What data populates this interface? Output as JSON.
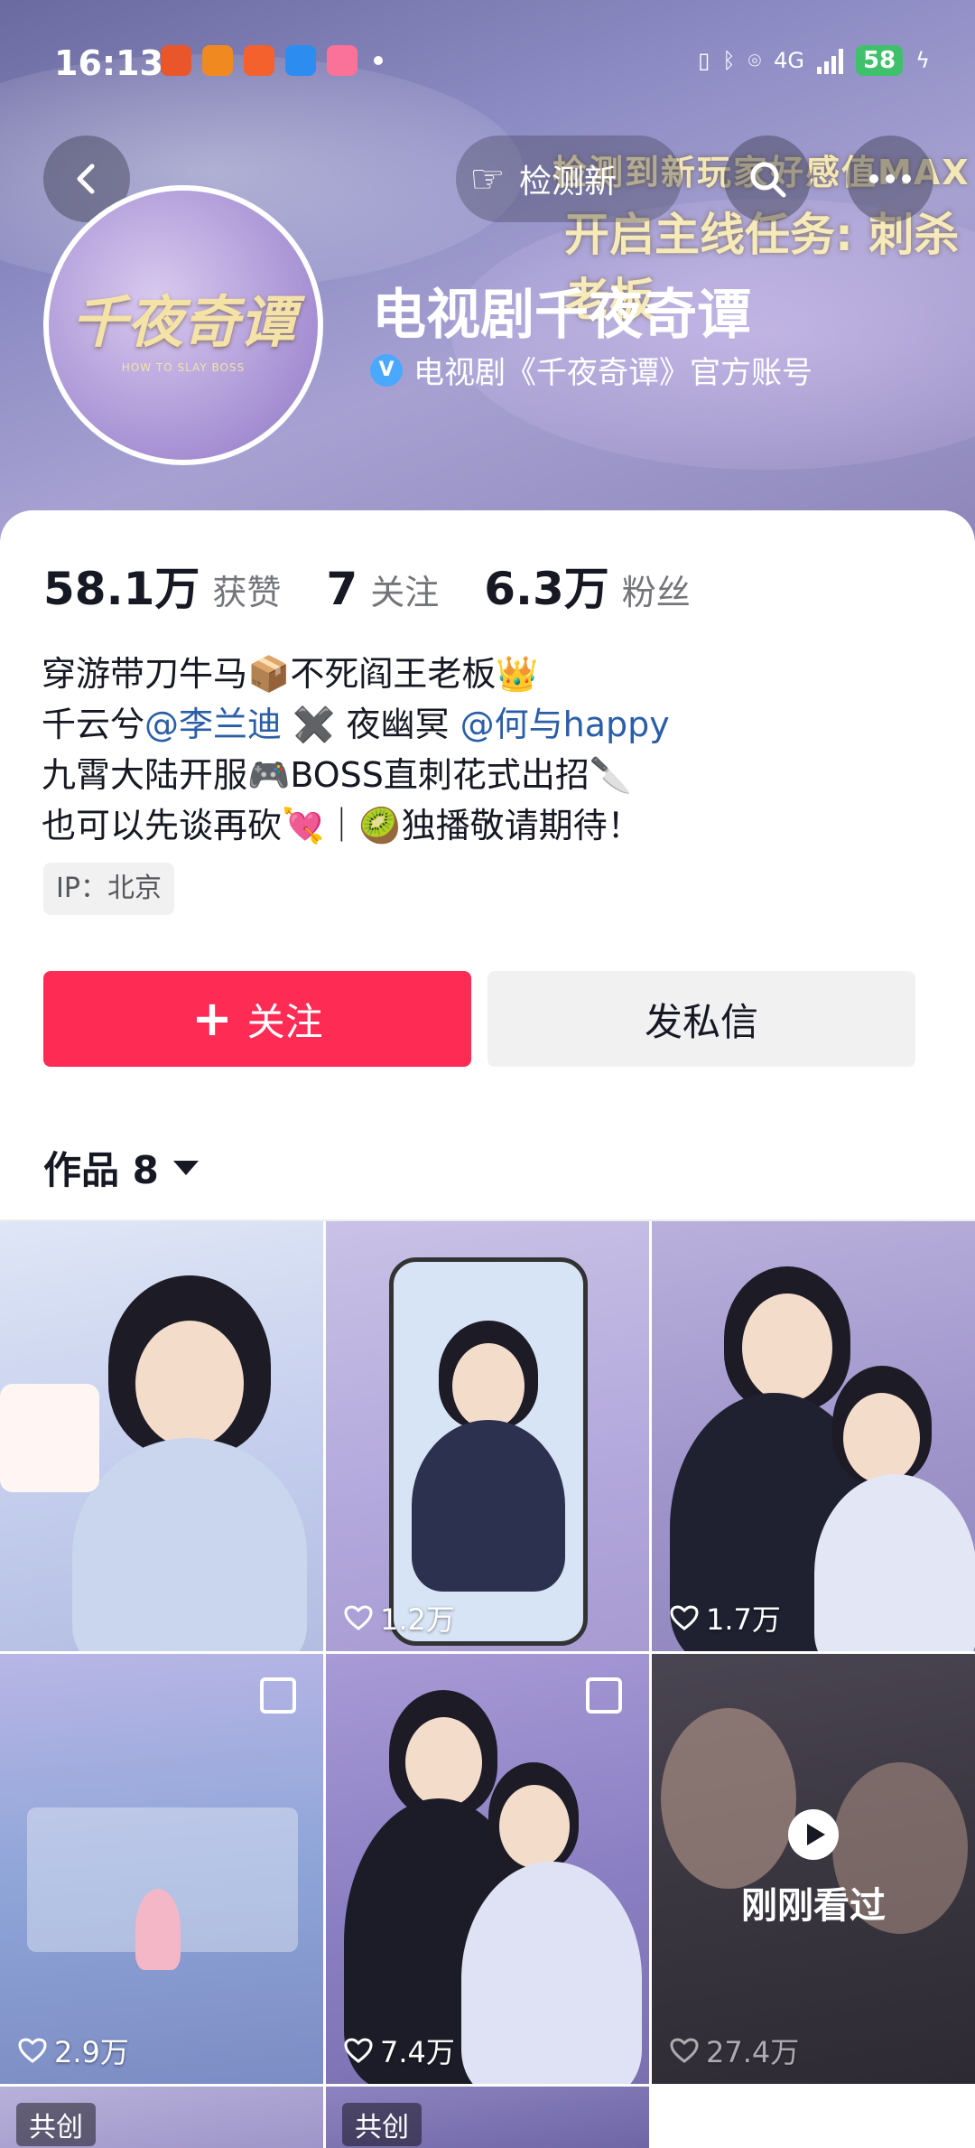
{
  "status_bar": {
    "time": "16:13",
    "battery": "58",
    "network": "4G"
  },
  "header": {
    "check_label": "检测新",
    "promo_line1": "检测到新玩家好感值MAX",
    "promo_line2": "开启主线任务: 刺杀老板",
    "avatar_logo": "千夜奇谭",
    "avatar_sub": "HOW TO SLAY BOSS",
    "account_name": "电视剧千夜奇谭",
    "verified_text": "电视剧《千夜奇谭》官方账号"
  },
  "stats": {
    "likes_value": "58.1万",
    "likes_label": "获赞",
    "following_value": "7",
    "following_label": "关注",
    "followers_value": "6.3万",
    "followers_label": "粉丝"
  },
  "bio": {
    "line1": "穿游带刀牛马📦不死阎王老板👑",
    "line2_a": "千云兮",
    "line2_mention1": "@李兰迪",
    "line2_b": " ✖️ 夜幽冥",
    "line2_mention2": "@何与happy",
    "line3": "九霄大陆开服🎮BOSS直刺花式出招🔪",
    "line4": "也可以先谈再砍💘｜🥝独播敬请期待！"
  },
  "ip_tag": "IP：北京",
  "actions": {
    "follow_label": "关注",
    "dm_label": "发私信"
  },
  "works": {
    "tab_label": "作品 8"
  },
  "videos": [
    {
      "likes": "",
      "multi": false
    },
    {
      "likes": "1.2万",
      "multi": false
    },
    {
      "likes": "1.7万",
      "multi": false
    },
    {
      "likes": "2.9万",
      "multi": true
    },
    {
      "likes": "7.4万",
      "multi": true
    },
    {
      "likes": "27.4万",
      "multi": false,
      "seen_label": "刚刚看过"
    },
    {
      "collab_label": "共创"
    },
    {
      "collab_label": "共创"
    }
  ],
  "colors": {
    "accent": "#fe2c55",
    "mention": "#2a5ea8",
    "verified": "#4aa8ff"
  }
}
